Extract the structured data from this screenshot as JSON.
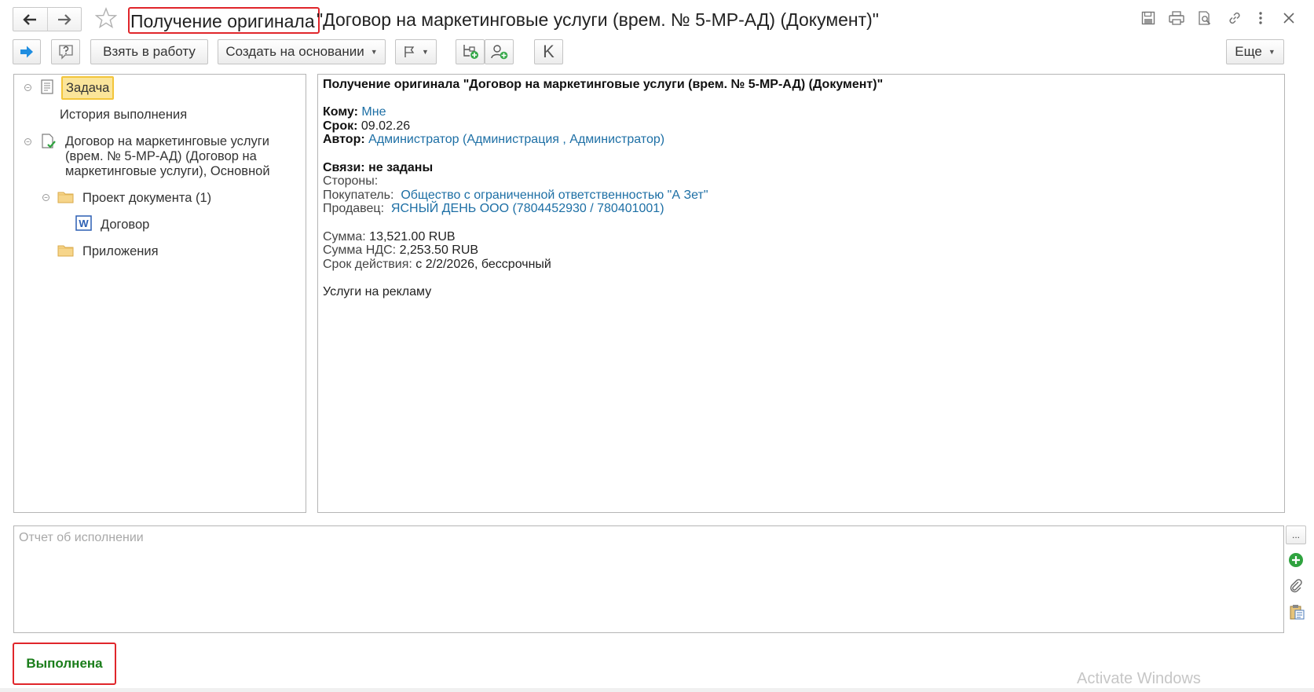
{
  "window": {
    "title_highlighted": "Получение оригинала",
    "title_rest": "\"Договор на маркетинговые услуги (врем. № 5-МР-АД) (Документ)\""
  },
  "toolbar": {
    "take_to_work": "Взять в работу",
    "create_based_on": "Создать на основании",
    "k_label": "K",
    "more": "Еще"
  },
  "tree": {
    "task": "Задача",
    "history": "История выполнения",
    "contract_lines": [
      "Договор на маркетинговые услуги",
      "(врем. № 5-МР-АД) (Договор на",
      "маркетинговые услуги), Основной"
    ],
    "project_doc": "Проект документа (1)",
    "word_file": "Договор",
    "attachments": "Приложения"
  },
  "document": {
    "header": "Получение оригинала \"Договор на маркетинговые услуги (врем. № 5-МР-АД) (Документ)\"",
    "to_label": "Кому:",
    "to_value": "Мне",
    "due_label": "Срок:",
    "due_value": "09.02.26",
    "author_label": "Автор:",
    "author_value": "Администратор (Администрация , Администратор)",
    "links_label": "Связи: не заданы",
    "parties_label": "Стороны:",
    "buyer_label": "Покупатель:",
    "buyer_value": "Общество с ограниченной ответственностью \"А Зет\"",
    "seller_label": "Продавец:",
    "seller_value": "ЯСНЫЙ ДЕНЬ ООО (7804452930 / 780401001)",
    "sum_label": "Сумма:",
    "sum_value": "13,521.00 RUB",
    "vat_label": "Сумма НДС:",
    "vat_value": "2,253.50 RUB",
    "validity_label": "Срок действия:",
    "validity_value": "с 2/2/2026, бессрочный",
    "subject": "Услуги на рекламу"
  },
  "report": {
    "placeholder": "Отчет об исполнении",
    "side_button": "..."
  },
  "footer": {
    "done_button": "Выполнена",
    "watermark": "Activate Windows"
  },
  "colors": {
    "highlight_border": "#e0262b",
    "selection_fill": "#fbe59a",
    "link": "#1d6fa5",
    "done_text": "#1a7d1a"
  }
}
